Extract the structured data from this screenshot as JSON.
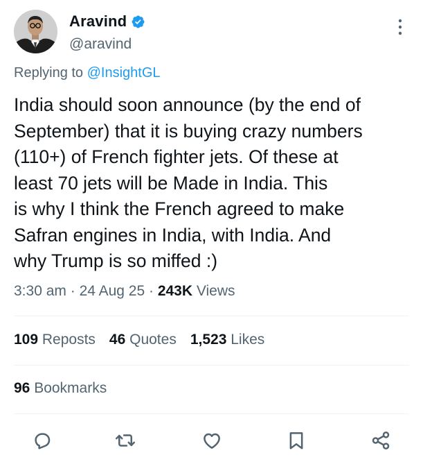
{
  "author": {
    "display_name": "Aravind",
    "handle": "@aravind",
    "verified": true
  },
  "reply": {
    "prefix": "Replying to ",
    "target": "@InsightGL"
  },
  "text": "India should soon announce (by the end of\nSeptember) that it is buying crazy numbers\n(110+) of French fighter jets. Of these at\nleast 70 jets will be Made in India. This\nis why I think the French agreed to make\nSafran engines in India, with India.  And\nwhy Trump is so miffed :)",
  "meta": {
    "time": "3:30 am",
    "separator": " · ",
    "date": "24 Aug 25",
    "views_count": "243K",
    "views_label": " Views"
  },
  "stats": {
    "reposts_count": "109",
    "reposts_label": " Reposts",
    "quotes_count": "46",
    "quotes_label": " Quotes",
    "likes_count": "1,523",
    "likes_label": " Likes",
    "bookmarks_count": "96",
    "bookmarks_label": " Bookmarks"
  },
  "actions": [
    "reply-icon",
    "repost-icon",
    "like-icon",
    "bookmark-icon",
    "share-icon"
  ],
  "colors": {
    "accent": "#1d9bf0",
    "text_primary": "#0f1419",
    "text_secondary": "#536471",
    "divider": "#eff3f4"
  }
}
